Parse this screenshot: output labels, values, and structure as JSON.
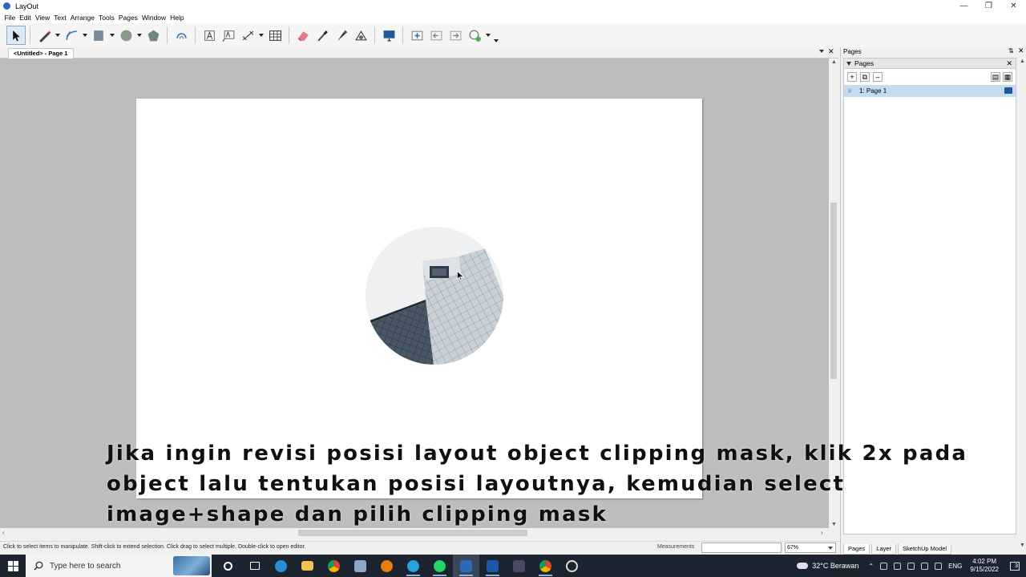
{
  "window": {
    "title": "LayOut"
  },
  "menu": [
    "File",
    "Edit",
    "View",
    "Text",
    "Arrange",
    "Tools",
    "Pages",
    "Window",
    "Help"
  ],
  "document": {
    "tab_label": "<Untitled> - Page 1"
  },
  "statusbar": {
    "hint": "Click to select items to manipulate. Shift-click to extend selection. Click drag to select multiple. Double-click to open editor.",
    "measurements_label": "Measurements",
    "measurements_value": "",
    "zoom": "67%"
  },
  "panel": {
    "title": "Pages",
    "section_title": "Pages",
    "pages": [
      {
        "label": "1: Page 1"
      }
    ],
    "tabs": [
      "Pages",
      "Layer",
      "SketchUp Model"
    ]
  },
  "subtitle": {
    "text": "Jika ingin revisi posisi layout object clipping mask, klik 2x pada object lalu tentukan posisi layoutnya, kemudian select image+shape dan pilih clipping mask"
  },
  "taskbar": {
    "search_placeholder": "Type here to search",
    "weather": "32°C Berawan",
    "language": "ENG",
    "time": "4:02 PM",
    "date": "9/15/2022",
    "notifications": "3"
  }
}
